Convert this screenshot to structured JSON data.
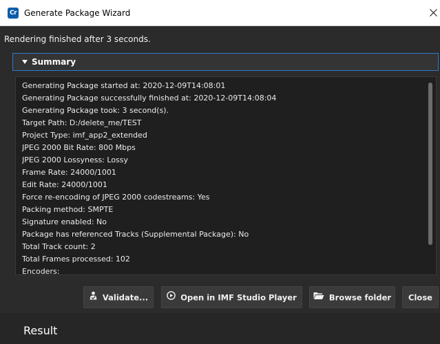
{
  "window": {
    "title": "Generate Package Wizard",
    "app_icon_text": "Cr"
  },
  "status": {
    "message": "Rendering finished after 3 seconds."
  },
  "summary": {
    "header": "Summary",
    "lines": [
      "Generating Package started at: 2020-12-09T14:08:01",
      "Generating Package successfully finished at: 2020-12-09T14:08:04",
      "Generating Package took: 3 second(s).",
      "Target Path: D:/delete_me/TEST",
      "Project Type: imf_app2_extended",
      "JPEG 2000 Bit Rate: 800 Mbps",
      "JPEG 2000 Lossyness: Lossy",
      "Frame Rate: 24000/1001",
      "Edit Rate: 24000/1001",
      "Force re-encoding of JPEG 2000 codestreams: Yes",
      "Packing method: SMPTE",
      "Signature enabled: No",
      "Package has referenced Tracks (Supplemental Package): No",
      "Total Track count: 2",
      "Total Frames processed: 102",
      "Encoders:"
    ]
  },
  "buttons": {
    "validate": "Validate...",
    "open_player": "Open in IMF Studio Player",
    "browse_folder": "Browse folder",
    "close": "Close"
  },
  "result": {
    "label": "Result"
  },
  "colors": {
    "background": "#2b2b2b",
    "log_background": "#1f1f1f",
    "accent_border": "#2d7ad2",
    "app_icon": "#0b5da8"
  },
  "icons": {
    "title": "app-icon",
    "close": "close-icon",
    "summary": "caret-down-icon",
    "validate": "validate-icon",
    "player": "play-circle-icon",
    "browse": "folder-icon"
  }
}
